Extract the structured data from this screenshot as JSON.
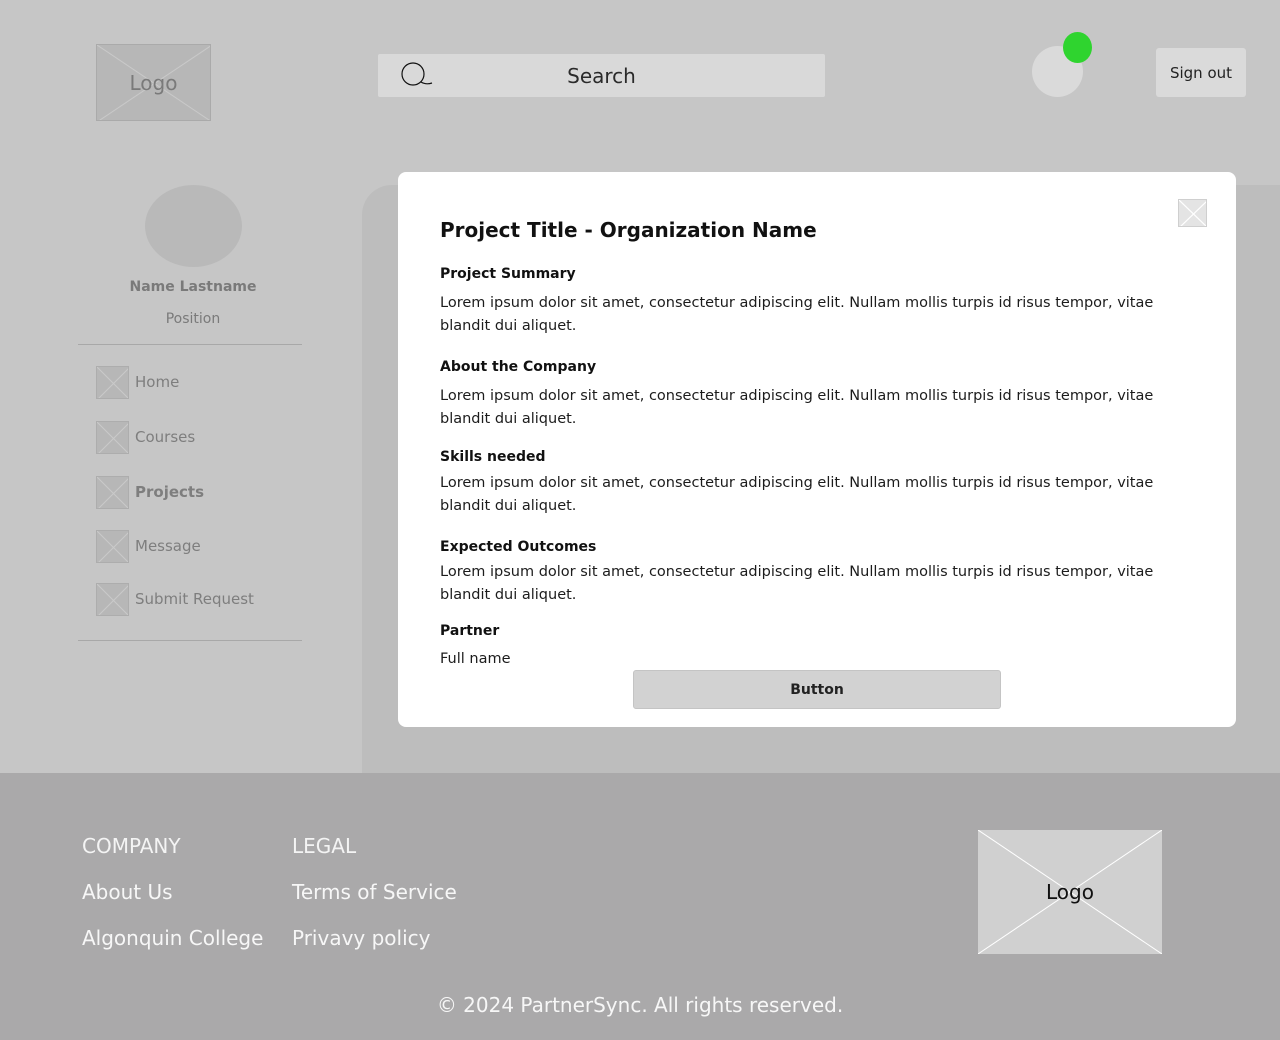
{
  "header": {
    "logo_text": "Logo",
    "search": {
      "placeholder": "Search"
    },
    "signout_label": "Sign out",
    "status_color": "#2fd42f"
  },
  "sidebar": {
    "name": "Name Lastname",
    "position": "Position",
    "items": [
      {
        "label": "Home",
        "icon": "placeholder-image-icon"
      },
      {
        "label": "Courses",
        "icon": "placeholder-image-icon"
      },
      {
        "label": "Projects",
        "icon": "placeholder-image-icon",
        "active": true
      },
      {
        "label": "Message",
        "icon": "placeholder-image-icon"
      },
      {
        "label": "Submit Request",
        "icon": "placeholder-image-icon"
      }
    ]
  },
  "modal": {
    "title": "Project Title - Organization Name",
    "sections": [
      {
        "heading": "Project Summary",
        "text": "Lorem ipsum dolor sit amet, consectetur adipiscing elit. Nullam mollis turpis id risus tempor, vitae blandit dui aliquet."
      },
      {
        "heading": "About the Company",
        "text": "Lorem ipsum dolor sit amet, consectetur adipiscing elit. Nullam mollis turpis id risus tempor, vitae blandit dui aliquet."
      },
      {
        "heading": "Skills needed",
        "text": "Lorem ipsum dolor sit amet, consectetur adipiscing elit. Nullam mollis turpis id risus tempor, vitae blandit dui aliquet."
      },
      {
        "heading": "Expected Outcomes",
        "text": "Lorem ipsum dolor sit amet, consectetur adipiscing elit. Nullam mollis turpis id risus tempor, vitae blandit dui aliquet."
      },
      {
        "heading": "Partner",
        "text": "Full name"
      }
    ],
    "button_label": "Button"
  },
  "footer": {
    "company_heading": "COMPANY",
    "company_links": [
      "About Us",
      "Algonquin College"
    ],
    "legal_heading": "LEGAL",
    "legal_links": [
      "Terms of Service",
      "Privavy policy"
    ],
    "logo_text": "Logo",
    "copyright": "© 2024 PartnerSync. All rights reserved."
  }
}
